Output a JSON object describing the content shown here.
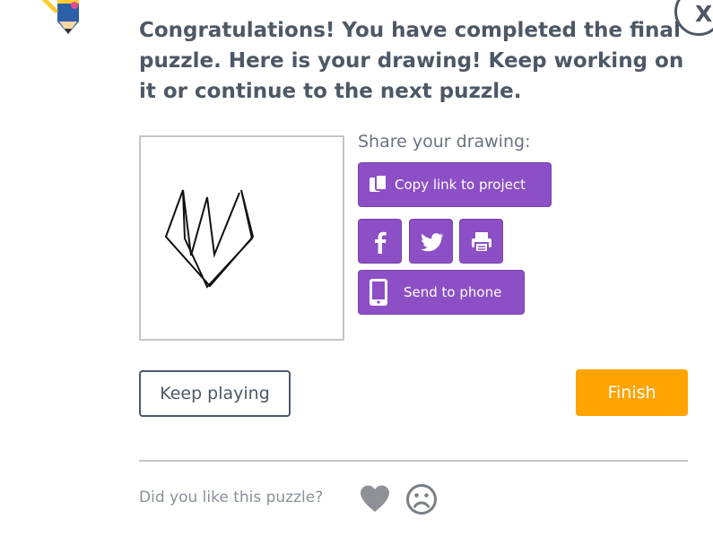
{
  "dialog": {
    "message": "Congratulations! You have completed the final puzzle. Here is your drawing! Keep working on it or continue to the next puzzle.",
    "close_label": "X"
  },
  "share": {
    "title": "Share your drawing:",
    "copy_link_label": "Copy link to project",
    "send_to_phone_label": "Send to phone",
    "social_icons": [
      "facebook-icon",
      "twitter-icon",
      "print-icon"
    ]
  },
  "actions": {
    "keep_playing_label": "Keep playing",
    "finish_label": "Finish"
  },
  "feedback": {
    "question": "Did you like this puzzle?"
  },
  "colors": {
    "accent_purple": "#8c4fc5",
    "finish_orange": "#ffa400",
    "text": "#4d5866"
  }
}
